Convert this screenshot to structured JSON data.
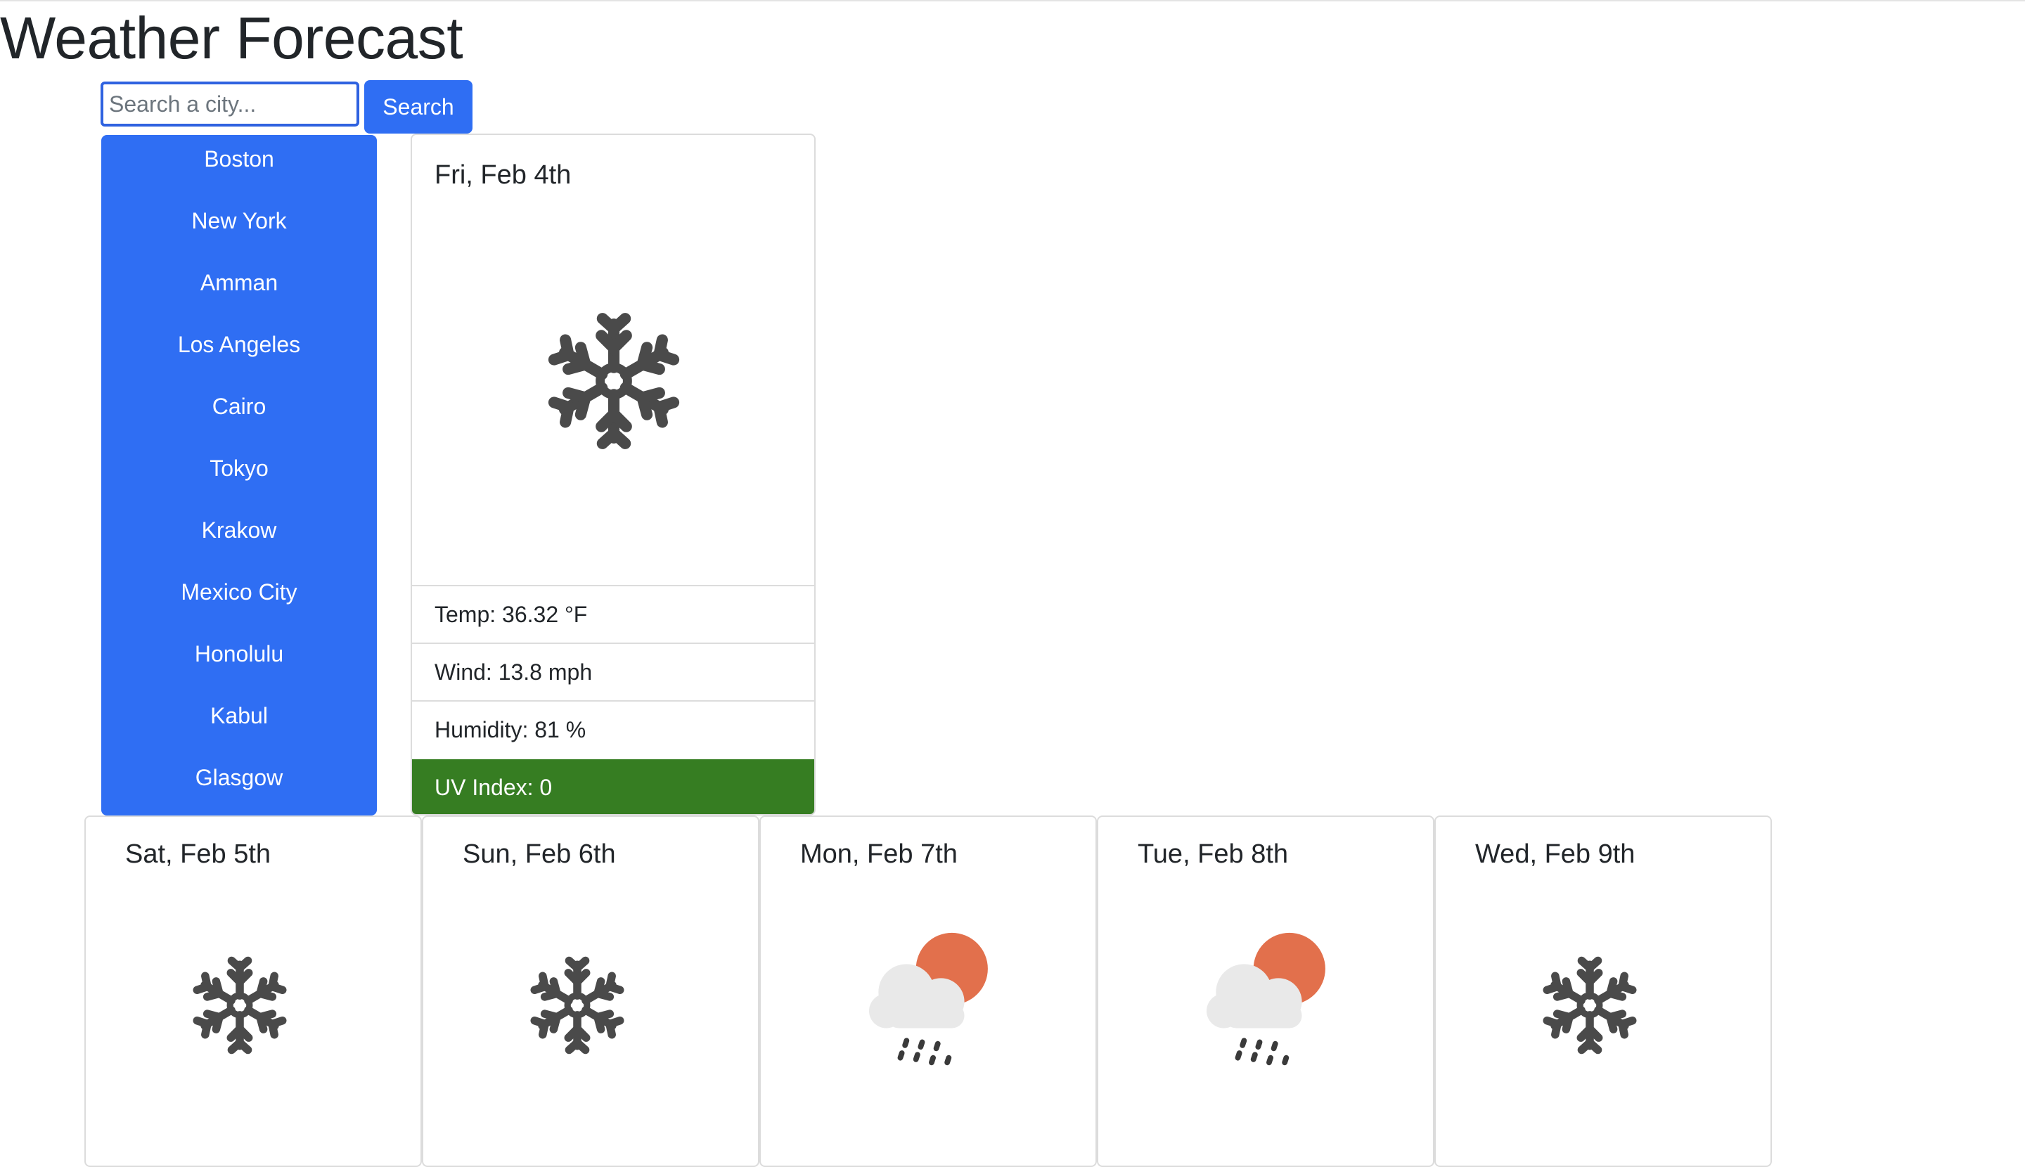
{
  "page": {
    "title": "Weather Forecast"
  },
  "search": {
    "placeholder": "Search a city...",
    "button_label": "Search"
  },
  "cities": [
    "Boston",
    "New York",
    "Amman",
    "Los Angeles",
    "Cairo",
    "Tokyo",
    "Krakow",
    "Mexico City",
    "Honolulu",
    "Kabul",
    "Glasgow"
  ],
  "today": {
    "date": "Fri, Feb 4th",
    "icon": "snowflake-icon",
    "temp": "Temp: 36.32 °F",
    "wind": "Wind: 13.8 mph",
    "humidity": "Humidity: 81 %",
    "uv": "UV Index: 0"
  },
  "forecast": [
    {
      "date": "Sat, Feb 5th",
      "icon": "snowflake-icon"
    },
    {
      "date": "Sun, Feb 6th",
      "icon": "snowflake-icon"
    },
    {
      "date": "Mon, Feb 7th",
      "icon": "cloud-sun-rain-icon"
    },
    {
      "date": "Tue, Feb 8th",
      "icon": "cloud-sun-rain-icon"
    },
    {
      "date": "Wed, Feb 9th",
      "icon": "snowflake-icon"
    }
  ],
  "colors": {
    "primary": "#2f6ef3",
    "uv_low": "#367d22",
    "icon_gray": "#4a4a4a",
    "sun": "#e2704c",
    "cloud": "#e9e9e9"
  }
}
